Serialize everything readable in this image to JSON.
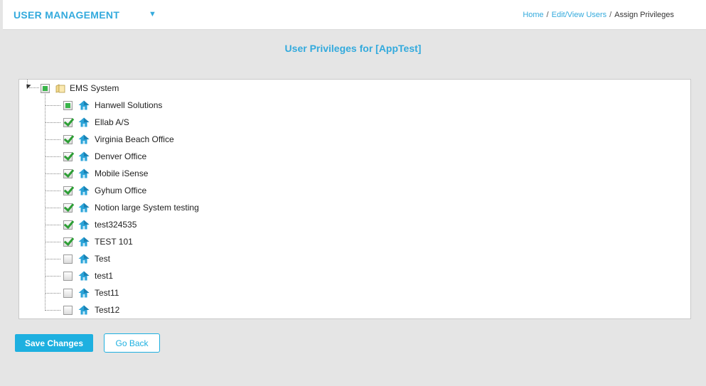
{
  "header": {
    "app_title": "USER MANAGEMENT",
    "breadcrumb": {
      "home": "Home",
      "edit_view_users": "Edit/View Users",
      "current": "Assign Privileges"
    }
  },
  "page": {
    "heading": "User Privileges for [AppTest]"
  },
  "tree": {
    "root": {
      "label": "EMS System",
      "state": "partial",
      "icon": "folder-icon"
    },
    "children": [
      {
        "label": "Hanwell Solutions",
        "state": "partial",
        "icon": "home-icon"
      },
      {
        "label": "Ellab A/S",
        "state": "checked",
        "icon": "home-icon"
      },
      {
        "label": "Virginia Beach Office",
        "state": "checked",
        "icon": "home-icon"
      },
      {
        "label": "Denver Office",
        "state": "checked",
        "icon": "home-icon"
      },
      {
        "label": "Mobile iSense",
        "state": "checked",
        "icon": "home-icon"
      },
      {
        "label": "Gyhum Office",
        "state": "checked",
        "icon": "home-icon"
      },
      {
        "label": "Notion large System testing",
        "state": "checked",
        "icon": "home-icon"
      },
      {
        "label": "test324535",
        "state": "checked",
        "icon": "home-icon"
      },
      {
        "label": "TEST 101",
        "state": "checked",
        "icon": "home-icon"
      },
      {
        "label": "Test",
        "state": "unchecked",
        "icon": "home-icon"
      },
      {
        "label": "test1",
        "state": "unchecked",
        "icon": "home-icon"
      },
      {
        "label": "Test11",
        "state": "unchecked",
        "icon": "home-icon"
      },
      {
        "label": "Test12",
        "state": "unchecked",
        "icon": "home-icon"
      }
    ]
  },
  "actions": {
    "save_label": "Save Changes",
    "back_label": "Go Back"
  },
  "colors": {
    "accent": "#33aadd",
    "check_green": "#2e9e36",
    "home_icon_blue": "#29a3d8"
  }
}
